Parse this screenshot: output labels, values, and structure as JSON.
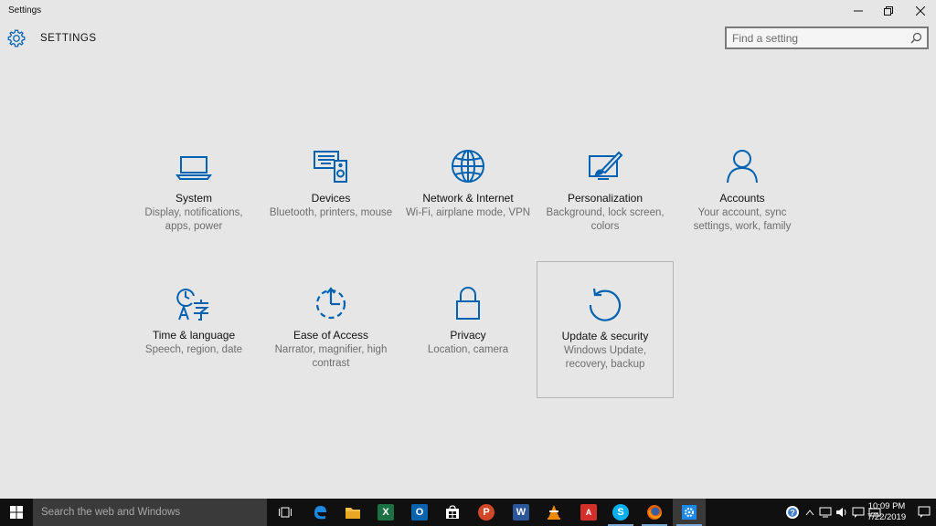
{
  "window": {
    "app_title": "Settings",
    "page_title": "SETTINGS",
    "search": {
      "placeholder": "Find a setting",
      "value": ""
    }
  },
  "accent_color": "#0063b1",
  "categories": [
    {
      "label": "System",
      "description": "Display, notifications, apps, power",
      "icon": "laptop-icon"
    },
    {
      "label": "Devices",
      "description": "Bluetooth, printers, mouse",
      "icon": "devices-icon"
    },
    {
      "label": "Network & Internet",
      "description": "Wi-Fi, airplane mode, VPN",
      "icon": "globe-icon"
    },
    {
      "label": "Personalization",
      "description": "Background, lock screen, colors",
      "icon": "paint-icon"
    },
    {
      "label": "Accounts",
      "description": "Your account, sync settings, work, family",
      "icon": "person-icon"
    },
    {
      "label": "Time & language",
      "description": "Speech, region, date",
      "icon": "time-language-icon"
    },
    {
      "label": "Ease of Access",
      "description": "Narrator, magnifier, high contrast",
      "icon": "ease-of-access-icon"
    },
    {
      "label": "Privacy",
      "description": "Location, camera",
      "icon": "lock-icon"
    },
    {
      "label": "Update & security",
      "description": "Windows Update, recovery, backup",
      "icon": "update-icon"
    }
  ],
  "taskbar": {
    "search_placeholder": "Search the web and Windows",
    "apps": [
      "task-view",
      "edge",
      "file-explorer",
      "excel",
      "outlook",
      "store",
      "powerpoint",
      "word",
      "vlc",
      "acrobat",
      "skype",
      "firefox",
      "settings"
    ],
    "clock": {
      "time": "10:09 PM",
      "date": "7/22/2019"
    }
  }
}
